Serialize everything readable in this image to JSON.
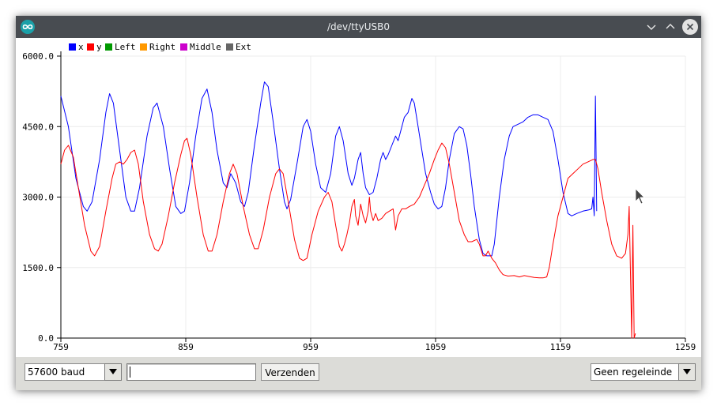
{
  "window": {
    "title": "/dev/ttyUSB0",
    "icon": "arduino-infinity-icon",
    "buttons": [
      "chevron-down-icon",
      "chevron-up-icon",
      "close-icon"
    ]
  },
  "legend": [
    {
      "label": "x",
      "color": "#0000ff"
    },
    {
      "label": "y",
      "color": "#ff0000"
    },
    {
      "label": "Left",
      "color": "#009900"
    },
    {
      "label": "Right",
      "color": "#ff9900"
    },
    {
      "label": "Middle",
      "color": "#cc00cc"
    },
    {
      "label": "Ext",
      "color": "#666666"
    }
  ],
  "chart_data": {
    "type": "line",
    "xlim": [
      759,
      1259
    ],
    "ylim": [
      0,
      6000
    ],
    "x_ticks": [
      759,
      859,
      959,
      1059,
      1159,
      1259
    ],
    "x_tick_labels": [
      "759",
      "859",
      "959",
      "1059",
      "1159",
      "1259"
    ],
    "y_ticks": [
      0,
      1500,
      3000,
      4500,
      6000
    ],
    "y_tick_labels": [
      "0.0",
      "1500.0",
      "3000.0",
      "4500.0",
      "6000.0"
    ],
    "grid": true,
    "legend_position": "top-left",
    "series": [
      {
        "name": "x",
        "color": "#0000ff",
        "points": [
          [
            759,
            5150
          ],
          [
            765,
            4500
          ],
          [
            771,
            3400
          ],
          [
            777,
            2800
          ],
          [
            780,
            2700
          ],
          [
            784,
            2900
          ],
          [
            790,
            3800
          ],
          [
            795,
            4800
          ],
          [
            798,
            5200
          ],
          [
            801,
            5000
          ],
          [
            806,
            4000
          ],
          [
            811,
            3000
          ],
          [
            815,
            2700
          ],
          [
            818,
            2700
          ],
          [
            822,
            3200
          ],
          [
            828,
            4300
          ],
          [
            833,
            4900
          ],
          [
            836,
            5000
          ],
          [
            841,
            4500
          ],
          [
            846,
            3600
          ],
          [
            851,
            2800
          ],
          [
            855,
            2650
          ],
          [
            858,
            2700
          ],
          [
            862,
            3300
          ],
          [
            867,
            4300
          ],
          [
            872,
            5100
          ],
          [
            876,
            5300
          ],
          [
            880,
            4800
          ],
          [
            884,
            4000
          ],
          [
            889,
            3300
          ],
          [
            892,
            3200
          ],
          [
            895,
            3500
          ],
          [
            899,
            3300
          ],
          [
            903,
            2900
          ],
          [
            906,
            2800
          ],
          [
            909,
            3100
          ],
          [
            914,
            4100
          ],
          [
            919,
            5000
          ],
          [
            922,
            5450
          ],
          [
            925,
            5350
          ],
          [
            929,
            4600
          ],
          [
            934,
            3600
          ],
          [
            938,
            2900
          ],
          [
            940,
            2750
          ],
          [
            943,
            2950
          ],
          [
            948,
            3700
          ],
          [
            953,
            4500
          ],
          [
            956,
            4650
          ],
          [
            959,
            4400
          ],
          [
            963,
            3700
          ],
          [
            967,
            3200
          ],
          [
            971,
            3100
          ],
          [
            975,
            3500
          ],
          [
            979,
            4300
          ],
          [
            982,
            4500
          ],
          [
            985,
            4200
          ],
          [
            989,
            3500
          ],
          [
            992,
            3250
          ],
          [
            994,
            3400
          ],
          [
            997,
            3800
          ],
          [
            999,
            3950
          ],
          [
            1001,
            3500
          ],
          [
            1003,
            3200
          ],
          [
            1006,
            3050
          ],
          [
            1009,
            3100
          ],
          [
            1012,
            3400
          ],
          [
            1015,
            3800
          ],
          [
            1017,
            3950
          ],
          [
            1019,
            3800
          ],
          [
            1021,
            3900
          ],
          [
            1024,
            4100
          ],
          [
            1027,
            4300
          ],
          [
            1029,
            4200
          ],
          [
            1031,
            4400
          ],
          [
            1034,
            4700
          ],
          [
            1037,
            4800
          ],
          [
            1040,
            5100
          ],
          [
            1042,
            5000
          ],
          [
            1045,
            4500
          ],
          [
            1048,
            4000
          ],
          [
            1051,
            3500
          ],
          [
            1055,
            3100
          ],
          [
            1058,
            2850
          ],
          [
            1061,
            2750
          ],
          [
            1064,
            2800
          ],
          [
            1067,
            3200
          ],
          [
            1070,
            3800
          ],
          [
            1074,
            4350
          ],
          [
            1078,
            4500
          ],
          [
            1081,
            4450
          ],
          [
            1084,
            4100
          ],
          [
            1087,
            3500
          ],
          [
            1090,
            2800
          ],
          [
            1094,
            2100
          ],
          [
            1097,
            1800
          ],
          [
            1100,
            1750
          ],
          [
            1104,
            1750
          ],
          [
            1106,
            2000
          ],
          [
            1110,
            3000
          ],
          [
            1114,
            3800
          ],
          [
            1118,
            4300
          ],
          [
            1121,
            4500
          ],
          [
            1125,
            4550
          ],
          [
            1129,
            4600
          ],
          [
            1133,
            4700
          ],
          [
            1137,
            4750
          ],
          [
            1141,
            4750
          ],
          [
            1145,
            4700
          ],
          [
            1149,
            4650
          ],
          [
            1153,
            4400
          ],
          [
            1157,
            3800
          ],
          [
            1161,
            3100
          ],
          [
            1165,
            2650
          ],
          [
            1168,
            2600
          ],
          [
            1172,
            2650
          ],
          [
            1177,
            2700
          ],
          [
            1182,
            2730
          ],
          [
            1184,
            2750
          ],
          [
            1185,
            3000
          ],
          [
            1186,
            2600
          ],
          [
            1187,
            5150
          ],
          [
            1188,
            2700
          ]
        ]
      },
      {
        "name": "y",
        "color": "#ff0000",
        "points": [
          [
            759,
            3700
          ],
          [
            762,
            4000
          ],
          [
            765,
            4100
          ],
          [
            769,
            3850
          ],
          [
            773,
            3200
          ],
          [
            778,
            2400
          ],
          [
            783,
            1850
          ],
          [
            786,
            1750
          ],
          [
            790,
            1950
          ],
          [
            795,
            2700
          ],
          [
            800,
            3400
          ],
          [
            803,
            3700
          ],
          [
            806,
            3750
          ],
          [
            809,
            3700
          ],
          [
            812,
            3800
          ],
          [
            815,
            3950
          ],
          [
            818,
            4000
          ],
          [
            821,
            3700
          ],
          [
            825,
            2900
          ],
          [
            830,
            2200
          ],
          [
            834,
            1900
          ],
          [
            837,
            1850
          ],
          [
            840,
            2000
          ],
          [
            845,
            2600
          ],
          [
            850,
            3300
          ],
          [
            855,
            3900
          ],
          [
            858,
            4200
          ],
          [
            860,
            4250
          ],
          [
            863,
            3900
          ],
          [
            868,
            3000
          ],
          [
            873,
            2200
          ],
          [
            877,
            1850
          ],
          [
            880,
            1850
          ],
          [
            884,
            2200
          ],
          [
            889,
            2900
          ],
          [
            894,
            3500
          ],
          [
            897,
            3700
          ],
          [
            900,
            3500
          ],
          [
            905,
            2800
          ],
          [
            910,
            2200
          ],
          [
            914,
            1900
          ],
          [
            917,
            1900
          ],
          [
            921,
            2300
          ],
          [
            926,
            3000
          ],
          [
            931,
            3500
          ],
          [
            934,
            3600
          ],
          [
            937,
            3500
          ],
          [
            941,
            2900
          ],
          [
            946,
            2100
          ],
          [
            950,
            1700
          ],
          [
            953,
            1650
          ],
          [
            956,
            1700
          ],
          [
            960,
            2200
          ],
          [
            965,
            2700
          ],
          [
            970,
            3000
          ],
          [
            973,
            3100
          ],
          [
            976,
            2900
          ],
          [
            979,
            2400
          ],
          [
            982,
            1950
          ],
          [
            984,
            1850
          ],
          [
            986,
            2000
          ],
          [
            988,
            2200
          ],
          [
            990,
            2450
          ],
          [
            992,
            2800
          ],
          [
            994,
            2950
          ],
          [
            995,
            2600
          ],
          [
            997,
            2400
          ],
          [
            999,
            2850
          ],
          [
            1001,
            2600
          ],
          [
            1003,
            2450
          ],
          [
            1005,
            2700
          ],
          [
            1006,
            3000
          ],
          [
            1007,
            2700
          ],
          [
            1009,
            2500
          ],
          [
            1011,
            2650
          ],
          [
            1013,
            2500
          ],
          [
            1016,
            2550
          ],
          [
            1019,
            2650
          ],
          [
            1022,
            2700
          ],
          [
            1025,
            2750
          ],
          [
            1027,
            2300
          ],
          [
            1029,
            2600
          ],
          [
            1032,
            2750
          ],
          [
            1035,
            2750
          ],
          [
            1038,
            2800
          ],
          [
            1042,
            2850
          ],
          [
            1046,
            3000
          ],
          [
            1050,
            3250
          ],
          [
            1054,
            3500
          ],
          [
            1058,
            3800
          ],
          [
            1061,
            4000
          ],
          [
            1064,
            4150
          ],
          [
            1067,
            4050
          ],
          [
            1070,
            3700
          ],
          [
            1074,
            3100
          ],
          [
            1078,
            2500
          ],
          [
            1082,
            2200
          ],
          [
            1085,
            2050
          ],
          [
            1088,
            2050
          ],
          [
            1092,
            2100
          ],
          [
            1094,
            2000
          ],
          [
            1097,
            1750
          ],
          [
            1099,
            1750
          ],
          [
            1101,
            1850
          ],
          [
            1104,
            1700
          ],
          [
            1107,
            1600
          ],
          [
            1110,
            1450
          ],
          [
            1113,
            1350
          ],
          [
            1117,
            1320
          ],
          [
            1122,
            1330
          ],
          [
            1126,
            1300
          ],
          [
            1130,
            1330
          ],
          [
            1134,
            1310
          ],
          [
            1138,
            1290
          ],
          [
            1142,
            1280
          ],
          [
            1145,
            1280
          ],
          [
            1148,
            1300
          ],
          [
            1150,
            1500
          ],
          [
            1153,
            2000
          ],
          [
            1157,
            2600
          ],
          [
            1161,
            3000
          ],
          [
            1165,
            3400
          ],
          [
            1169,
            3500
          ],
          [
            1173,
            3600
          ],
          [
            1177,
            3700
          ],
          [
            1181,
            3750
          ],
          [
            1185,
            3800
          ],
          [
            1187,
            3800
          ],
          [
            1189,
            3600
          ],
          [
            1192,
            3100
          ],
          [
            1196,
            2500
          ],
          [
            1200,
            2000
          ],
          [
            1204,
            1750
          ],
          [
            1208,
            1700
          ],
          [
            1211,
            1800
          ],
          [
            1213,
            2200
          ],
          [
            1214,
            2800
          ],
          [
            1215,
            1400
          ],
          [
            1216,
            0
          ],
          [
            1217,
            2400
          ],
          [
            1218,
            0
          ],
          [
            1219,
            100
          ]
        ]
      },
      {
        "name": "Left",
        "color": "#009900",
        "points": []
      },
      {
        "name": "Right",
        "color": "#ff9900",
        "points": []
      },
      {
        "name": "Middle",
        "color": "#cc00cc",
        "points": []
      },
      {
        "name": "Ext",
        "color": "#666666",
        "points": []
      }
    ]
  },
  "controls": {
    "baud": "57600 baud",
    "send_input_value": "",
    "send_label": "Verzenden",
    "line_ending": "Geen regeleinde"
  }
}
